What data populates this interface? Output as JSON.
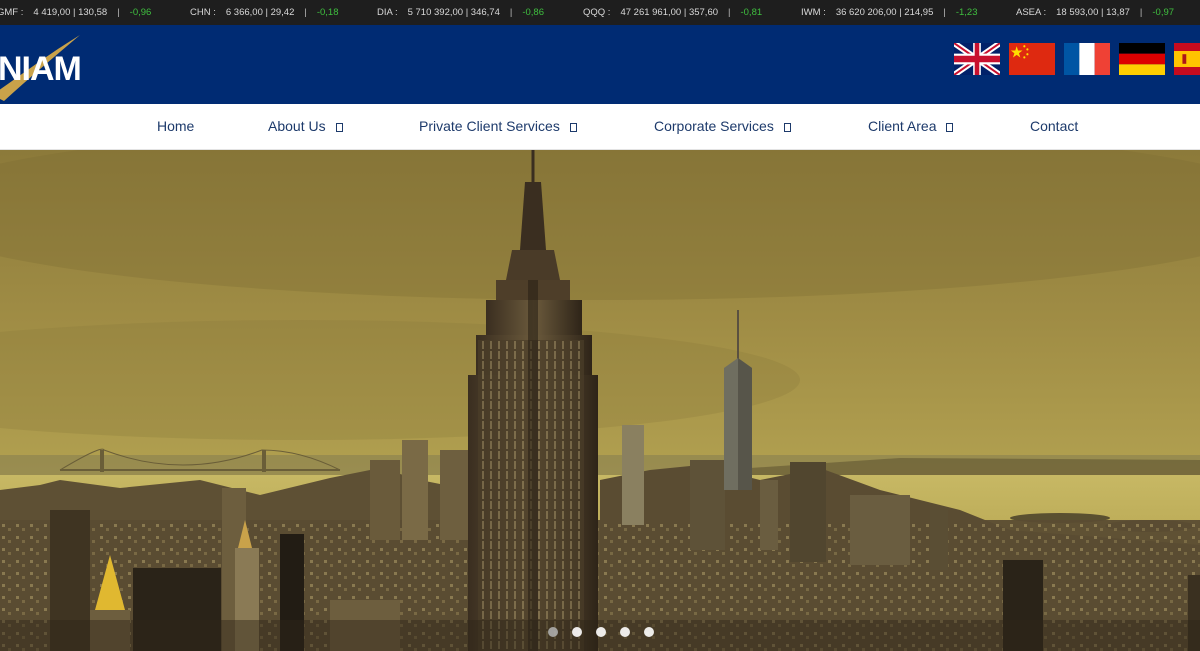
{
  "ticker": [
    {
      "symbol": "GMF :",
      "value": "4 419,00 | 130,58",
      "change": "-0,96"
    },
    {
      "symbol": "CHN :",
      "value": "6 366,00 | 29,42",
      "change": "-0,18"
    },
    {
      "symbol": "DIA :",
      "value": "5 710 392,00 | 346,74",
      "change": "-0,86"
    },
    {
      "symbol": "QQQ :",
      "value": "47 261 961,00 | 357,60",
      "change": "-0,81"
    },
    {
      "symbol": "IWM :",
      "value": "36 620 206,00 | 214,95",
      "change": "-1,23"
    },
    {
      "symbol": "ASEA :",
      "value": "18 593,00 | 13,87",
      "change": "-0,97"
    }
  ],
  "ticker_separator": "|",
  "brand": {
    "logo_text": "NIAM"
  },
  "languages": [
    "english-flag-icon",
    "chinese-flag-icon",
    "french-flag-icon",
    "german-flag-icon",
    "spanish-flag-icon"
  ],
  "nav": {
    "home": "Home",
    "about": "About Us",
    "private": "Private Client Services",
    "corporate": "Corporate Services",
    "client_area": "Client Area",
    "contact": "Contact"
  },
  "slider": {
    "slides": 5,
    "active_index": 0
  },
  "colors": {
    "header_bg": "#002b73",
    "nav_text": "#1d3a6b",
    "ticker_positive": "#3fbf3f",
    "logo_accent": "#c9a24a"
  }
}
